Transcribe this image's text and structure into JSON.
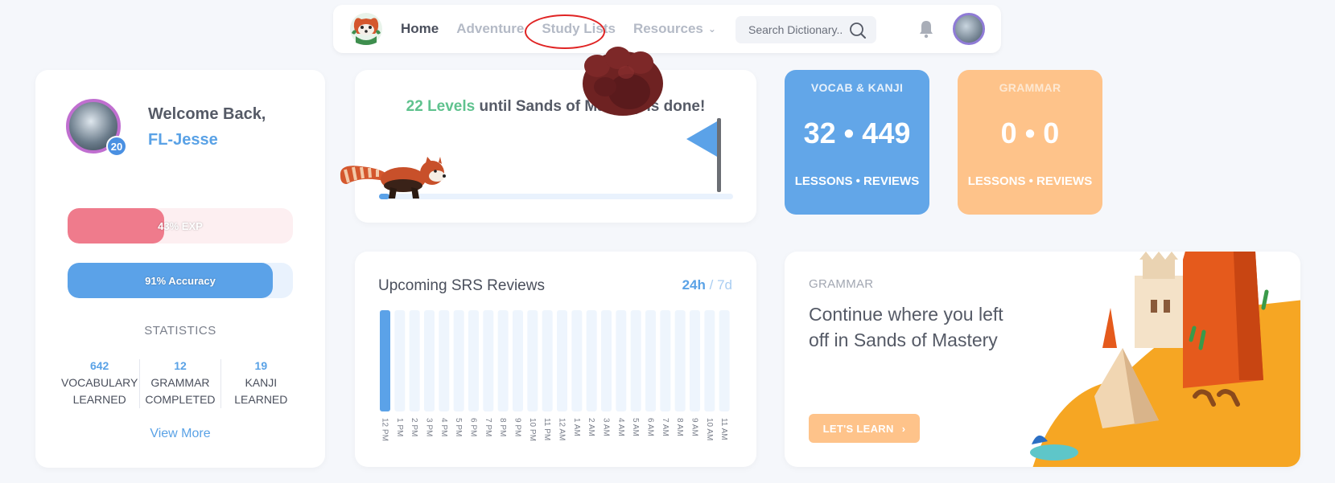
{
  "nav": {
    "home": "Home",
    "adventure": "Adventure",
    "study_lists": "Study Lists",
    "resources": "Resources",
    "search_placeholder": "Search Dictionary.."
  },
  "profile": {
    "welcome": "Welcome Back,",
    "username": "FL-Jesse",
    "level": "20",
    "exp_label": "43% EXP",
    "exp_percent": 43,
    "accuracy_label": "91% Accuracy",
    "accuracy_percent": 91,
    "statistics_title": "STATISTICS",
    "stats": [
      {
        "value": "642",
        "line1": "VOCABULARY",
        "line2": "LEARNED"
      },
      {
        "value": "12",
        "line1": "GRAMMAR",
        "line2": "COMPLETED"
      },
      {
        "value": "19",
        "line1": "KANJI",
        "line2": "LEARNED"
      }
    ],
    "view_more": "View More"
  },
  "progress": {
    "levels": "22 Levels",
    "rest": " until Sands of Mastery is done!",
    "percent": 3
  },
  "vocab_tile": {
    "title": "VOCAB & KANJI",
    "count": "32 • 449",
    "footer": "LESSONS • REVIEWS"
  },
  "grammar_tile": {
    "title": "GRAMMAR",
    "count": "0 • 0",
    "footer": "LESSONS • REVIEWS"
  },
  "srs": {
    "title": "Upcoming SRS Reviews",
    "toggle_active": "24h",
    "toggle_sep": "/",
    "toggle_inactive": "7d"
  },
  "lesson": {
    "category": "GRAMMAR",
    "text": "Continue where you left off in Sands of Mastery",
    "button": "LET'S LEARN"
  },
  "colors": {
    "accent_blue": "#5ba2e8",
    "exp_pink": "#ef7b8c",
    "grammar_orange": "#fec38a",
    "green": "#5fc28e"
  },
  "chart_data": {
    "type": "bar",
    "categories": [
      "12 PM",
      "1 PM",
      "2 PM",
      "3 PM",
      "4 PM",
      "5 PM",
      "6 PM",
      "7 PM",
      "8 PM",
      "9 PM",
      "10 PM",
      "11 PM",
      "12 AM",
      "1 AM",
      "2 AM",
      "3 AM",
      "4 AM",
      "5 AM",
      "6 AM",
      "7 AM",
      "8 AM",
      "9 AM",
      "10 AM",
      "11 AM"
    ],
    "values": [
      1,
      0,
      0,
      0,
      0,
      0,
      0,
      0,
      0,
      0,
      0,
      0,
      0,
      0,
      0,
      0,
      0,
      0,
      0,
      0,
      0,
      0,
      0,
      0
    ],
    "title": "Upcoming SRS Reviews",
    "grid": false
  }
}
